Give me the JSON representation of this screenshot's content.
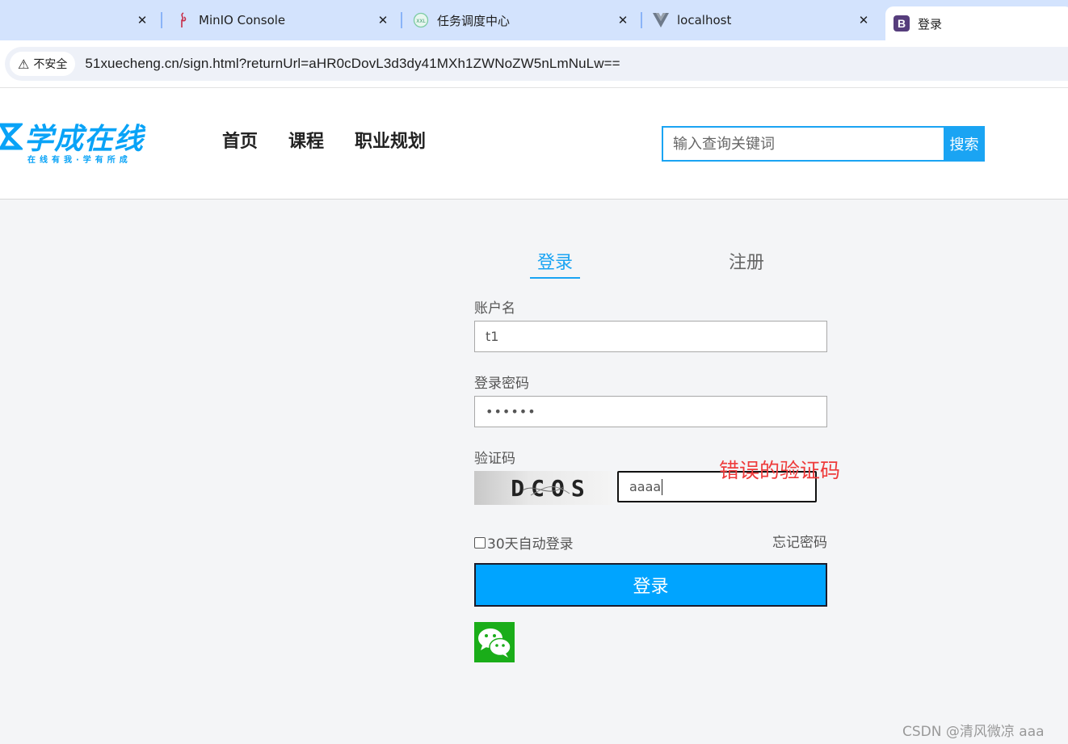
{
  "browser": {
    "tabs": [
      {
        "title": "",
        "icon": "blank-tab"
      },
      {
        "title": "MinIO Console",
        "icon": "minio-icon"
      },
      {
        "title": "任务调度中心",
        "icon": "xxl-job-icon"
      },
      {
        "title": "localhost",
        "icon": "vue-icon"
      }
    ],
    "active_tab": {
      "title": "登录",
      "icon_letter": "B",
      "icon": "bootstrap-icon"
    },
    "close_glyph": "✕",
    "security_label": "不安全",
    "warning_glyph": "⚠",
    "url": "51xuecheng.cn/sign.html?returnUrl=aHR0cDovL3d3dy41MXh1ZWNoZW5nLmNuLw=="
  },
  "header": {
    "logo_title": "学成在线",
    "logo_subtitle": "在线有我·学有所成",
    "nav": [
      "首页",
      "课程",
      "职业规划"
    ],
    "search_placeholder": "输入查询关键词",
    "search_button": "搜索",
    "brand_color": "#09a3f7"
  },
  "login": {
    "tab_login": "登录",
    "tab_register": "注册",
    "username_label": "账户名",
    "username_value": "t1",
    "password_label": "登录密码",
    "password_value": "••••••",
    "captcha_label": "验证码",
    "captcha_image_text": "DCOS",
    "captcha_value": "aaaa",
    "error_note": "错误的验证码",
    "remember_label": "30天自动登录",
    "forgot_label": "忘记密码",
    "submit_label": "登录",
    "wechat_icon": "wechat-icon",
    "accent_color": "#00a4ff",
    "error_color": "#ee3b3b"
  },
  "watermark": "CSDN @清风微凉 aaa"
}
